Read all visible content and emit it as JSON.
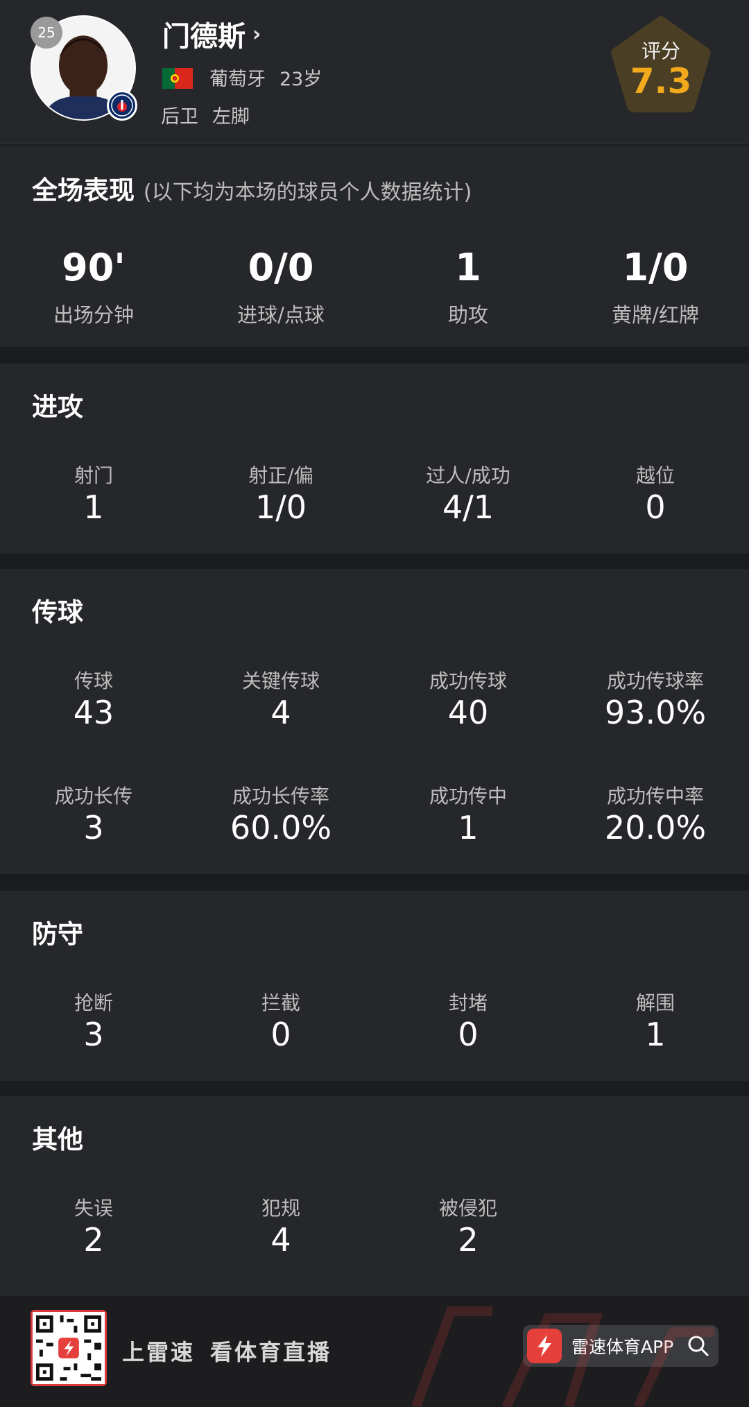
{
  "player": {
    "jersey_number": "25",
    "name": "门德斯",
    "name_chevron": "›",
    "nationality": "葡萄牙",
    "age": "23岁",
    "position": "后卫",
    "foot": "左脚",
    "club_badge_text": "PARIS",
    "rating_label": "评分",
    "rating": "7.3"
  },
  "overview": {
    "title": "全场表现",
    "subtitle": "(以下均为本场的球员个人数据统计)",
    "stats": [
      {
        "value": "90'",
        "label": "出场分钟"
      },
      {
        "value": "0/0",
        "label": "进球/点球"
      },
      {
        "value": "1",
        "label": "助攻"
      },
      {
        "value": "1/0",
        "label": "黄牌/红牌"
      }
    ]
  },
  "attack": {
    "title": "进攻",
    "stats": [
      {
        "label": "射门",
        "value": "1"
      },
      {
        "label": "射正/偏",
        "value": "1/0"
      },
      {
        "label": "过人/成功",
        "value": "4/1"
      },
      {
        "label": "越位",
        "value": "0"
      }
    ]
  },
  "passing": {
    "title": "传球",
    "stats": [
      {
        "label": "传球",
        "value": "43"
      },
      {
        "label": "关键传球",
        "value": "4"
      },
      {
        "label": "成功传球",
        "value": "40"
      },
      {
        "label": "成功传球率",
        "value": "93.0%"
      },
      {
        "label": "成功长传",
        "value": "3"
      },
      {
        "label": "成功长传率",
        "value": "60.0%"
      },
      {
        "label": "成功传中",
        "value": "1"
      },
      {
        "label": "成功传中率",
        "value": "20.0%"
      }
    ]
  },
  "defense": {
    "title": "防守",
    "stats": [
      {
        "label": "抢断",
        "value": "3"
      },
      {
        "label": "拦截",
        "value": "0"
      },
      {
        "label": "封堵",
        "value": "0"
      },
      {
        "label": "解围",
        "value": "1"
      }
    ]
  },
  "other": {
    "title": "其他",
    "stats": [
      {
        "label": "失误",
        "value": "2"
      },
      {
        "label": "犯规",
        "value": "4"
      },
      {
        "label": "被侵犯",
        "value": "2"
      }
    ]
  },
  "footer": {
    "slogan_1": "上雷速",
    "slogan_2": "看体育直播",
    "app_name": "雷速体育APP"
  },
  "colors": {
    "background": "#1b1c1f",
    "panel": "#26272a",
    "rating_accent": "#f2a91c",
    "rating_bg": "#4a3f24",
    "brand_red": "#e5403b"
  },
  "icons": [
    "chevron-right-icon",
    "portugal-flag-icon",
    "club-badge-icon",
    "qr-code-icon",
    "lightning-logo-icon",
    "search-icon"
  ]
}
